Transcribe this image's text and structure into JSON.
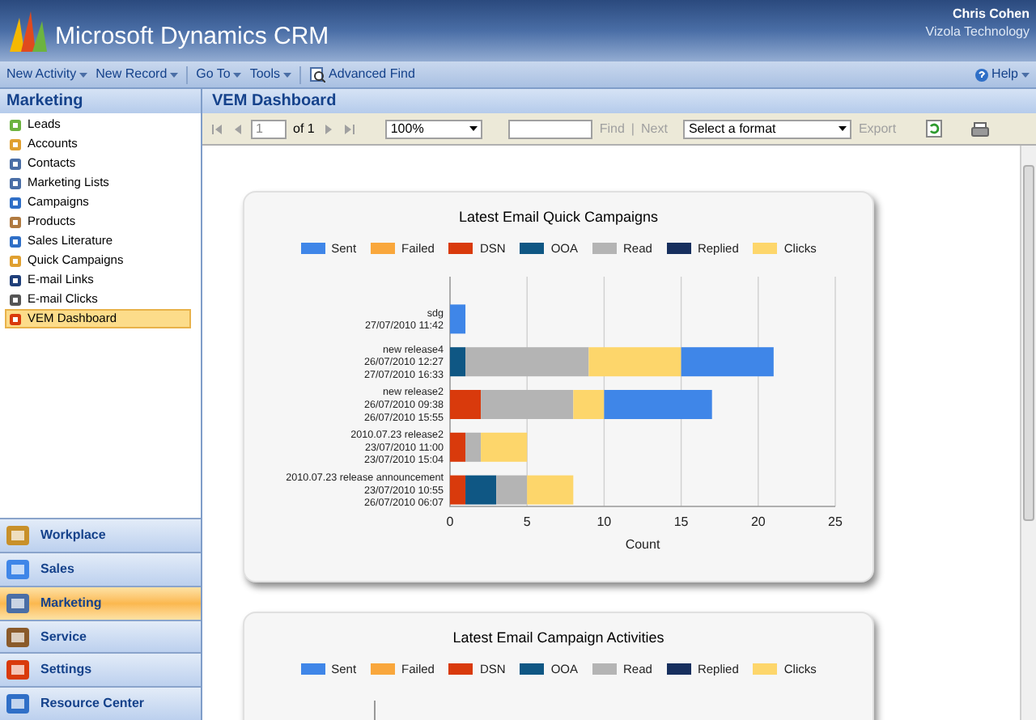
{
  "header": {
    "product": "Microsoft Dynamics CRM",
    "user": "Chris Cohen",
    "organization": "Vizola Technology"
  },
  "toolbar": {
    "items": [
      {
        "label": "New Activity",
        "kind": "menu"
      },
      {
        "label": "New Record",
        "kind": "menu"
      },
      {
        "label": "Go To",
        "kind": "menu"
      },
      {
        "label": "Tools",
        "kind": "menu"
      },
      {
        "label": "Advanced Find",
        "kind": "button"
      }
    ],
    "help": "Help"
  },
  "sidebar": {
    "title": "Marketing",
    "items": [
      {
        "label": "Leads",
        "selected": false
      },
      {
        "label": "Accounts",
        "selected": false
      },
      {
        "label": "Contacts",
        "selected": false
      },
      {
        "label": "Marketing Lists",
        "selected": false
      },
      {
        "label": "Campaigns",
        "selected": false
      },
      {
        "label": "Products",
        "selected": false
      },
      {
        "label": "Sales Literature",
        "selected": false
      },
      {
        "label": "Quick Campaigns",
        "selected": false
      },
      {
        "label": "E-mail Links",
        "selected": false
      },
      {
        "label": "E-mail Clicks",
        "selected": false
      },
      {
        "label": "VEM Dashboard",
        "selected": true
      }
    ],
    "nav": [
      {
        "label": "Workplace",
        "selected": false
      },
      {
        "label": "Sales",
        "selected": false
      },
      {
        "label": "Marketing",
        "selected": true
      },
      {
        "label": "Service",
        "selected": false
      },
      {
        "label": "Settings",
        "selected": false
      },
      {
        "label": "Resource Center",
        "selected": false
      }
    ]
  },
  "main": {
    "title": "VEM Dashboard",
    "report_toolbar": {
      "page": "1",
      "of": "of 1",
      "zoom": "100%",
      "find": "Find",
      "separator": "|",
      "next": "Next",
      "format": "Select a format",
      "export": "Export"
    },
    "charts": [
      {
        "chart_data": {
          "type": "bar",
          "orientation": "horizontal",
          "stacked": true,
          "grid": true,
          "legend": "top",
          "title": "Latest Email Quick Campaigns",
          "xlabel": "Count",
          "categories": [
            "sdg\n27/07/2010 11:42",
            "new release4\n26/07/2010 12:27\n27/07/2010 16:33",
            "new release2\n26/07/2010 09:38\n26/07/2010 15:55",
            "2010.07.23 release2\n23/07/2010 11:00\n23/07/2010 15:04",
            "2010.07.23 release announcement\n23/07/2010 10:55\n26/07/2010 06:07"
          ],
          "xlim": [
            0,
            25
          ],
          "xticks": [
            0,
            5,
            10,
            15,
            20,
            25
          ],
          "series": [
            {
              "name": "Sent",
              "color": "#3f86e8",
              "values": [
                1,
                6,
                7,
                0,
                0
              ]
            },
            {
              "name": "Failed",
              "color": "#f9a73c",
              "values": [
                0,
                0,
                0,
                0,
                0
              ]
            },
            {
              "name": "DSN",
              "color": "#d93a0c",
              "values": [
                0,
                0,
                2,
                1,
                1
              ]
            },
            {
              "name": "OOA",
              "color": "#0f5784",
              "values": [
                0,
                1,
                0,
                0,
                2
              ]
            },
            {
              "name": "Read",
              "color": "#b4b4b4",
              "values": [
                0,
                8,
                6,
                1,
                2
              ]
            },
            {
              "name": "Replied",
              "color": "#172f5e",
              "values": [
                0,
                0,
                0,
                0,
                0
              ]
            },
            {
              "name": "Clicks",
              "color": "#fdd66b",
              "values": [
                0,
                6,
                2,
                3,
                3
              ]
            }
          ]
        }
      },
      {
        "title": "Latest Email Campaign Activities",
        "legend": [
          {
            "name": "Sent",
            "color": "#3f86e8"
          },
          {
            "name": "Failed",
            "color": "#f9a73c"
          },
          {
            "name": "DSN",
            "color": "#d93a0c"
          },
          {
            "name": "OOA",
            "color": "#0f5784"
          },
          {
            "name": "Read",
            "color": "#b4b4b4"
          },
          {
            "name": "Replied",
            "color": "#172f5e"
          },
          {
            "name": "Clicks",
            "color": "#fdd66b"
          }
        ]
      }
    ]
  }
}
